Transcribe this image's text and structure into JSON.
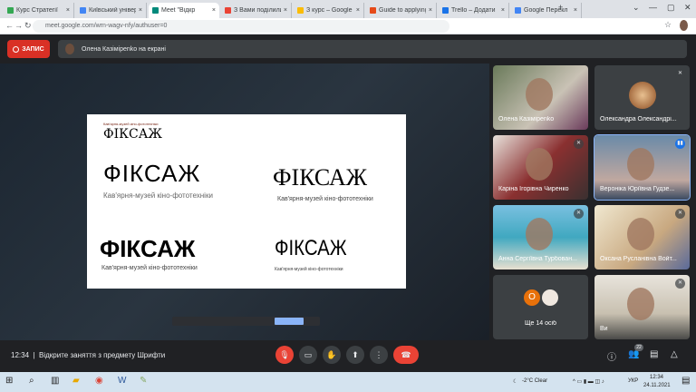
{
  "browser": {
    "tabs": [
      {
        "title": "Курс Стратегії",
        "color": "#34a853"
      },
      {
        "title": "Київський універ",
        "color": "#4285f4"
      },
      {
        "title": "Meet \"Відкр",
        "color": "#00897b",
        "active": true
      },
      {
        "title": "З Вами поділили",
        "color": "#ea4335"
      },
      {
        "title": "З курс – Google",
        "color": "#fbbc04"
      },
      {
        "title": "Guide to applying",
        "color": "#e64a19"
      },
      {
        "title": "Trello – Додати",
        "color": "#1a73e8"
      },
      {
        "title": "Google Перекл",
        "color": "#4285f4"
      }
    ],
    "new_tab": "+",
    "close": "×",
    "url": "meet.google.com/wrn-wagv-nfy/authuser=0"
  },
  "meet": {
    "record_label": "ЗАПИС",
    "presenting_banner": "Олена Казімірenko на екрані",
    "slide": {
      "small_logo_caption": "Кав'ярня-музей кіно-фототехніки",
      "logos": [
        {
          "title": "ФІКСАЖ",
          "subtitle": "Кав'ярня-музей кіно-фототехніки"
        },
        {
          "title": "ФІКСАЖ",
          "subtitle": "Кав'ярня-музей кіно-фототехніки"
        },
        {
          "title": "ФІКСАЖ",
          "subtitle": "Кав'ярня-музей кіно-фототехніки"
        },
        {
          "title": "ФІКСАЖ",
          "subtitle": "Кав'ярня-музей кіно-фототехніки"
        }
      ],
      "small_logo": "ФІКСАЖ"
    },
    "participants": [
      {
        "name": "Олена Казімірenko",
        "muted": false
      },
      {
        "name": "Олександра Олександрі...",
        "muted": true
      },
      {
        "name": "Каріна Ігорівна Чиренко",
        "muted": true
      },
      {
        "name": "Вероніка Юріївна Гудзе...",
        "muted": false,
        "speaking": true
      },
      {
        "name": "Анна Сергіївна Турбован...",
        "muted": true
      },
      {
        "name": "Оксана Русланівна Войт...",
        "muted": true
      },
      {
        "name": "Ще 14 осіб",
        "avatar_letter": "О"
      },
      {
        "name": "Ви",
        "muted": true
      }
    ],
    "time": "12:34",
    "meeting_title": "Відкрите заняття з предмету Шрифти",
    "participant_count": "22"
  },
  "taskbar": {
    "weather": "-2°C Clear",
    "lang": "УКР",
    "time": "12:34",
    "date": "24.11.2021"
  }
}
